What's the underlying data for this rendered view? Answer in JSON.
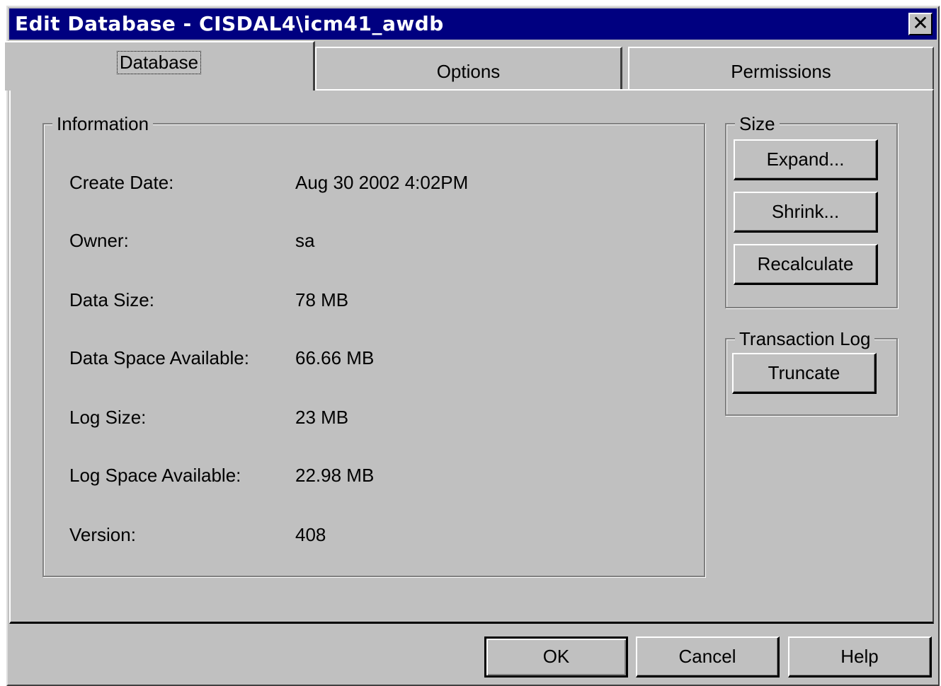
{
  "window": {
    "title": "Edit Database -  CISDAL4\\icm41_awdb",
    "close_glyph": "✕"
  },
  "tabs": [
    {
      "label": "Database",
      "active": true
    },
    {
      "label": "Options",
      "active": false
    },
    {
      "label": "Permissions",
      "active": false
    }
  ],
  "information": {
    "group_title": "Information",
    "rows": [
      {
        "label": "Create Date:",
        "value": "Aug 30 2002  4:02PM"
      },
      {
        "label": "Owner:",
        "value": "sa"
      },
      {
        "label": "Data Size:",
        "value": "78 MB"
      },
      {
        "label": "Data Space Available:",
        "value": "66.66 MB"
      },
      {
        "label": "Log Size:",
        "value": "23 MB"
      },
      {
        "label": "Log Space Available:",
        "value": "22.98 MB"
      },
      {
        "label": "Version:",
        "value": "408"
      }
    ]
  },
  "size": {
    "group_title": "Size",
    "expand_label": "Expand...",
    "shrink_label": "Shrink...",
    "recalculate_label": "Recalculate"
  },
  "transaction_log": {
    "group_title": "Transaction Log",
    "truncate_label": "Truncate"
  },
  "footer": {
    "ok_label": "OK",
    "cancel_label": "Cancel",
    "help_label": "Help"
  },
  "colors": {
    "title_bar": "#000080",
    "dialog_face": "#c0c0c0"
  }
}
